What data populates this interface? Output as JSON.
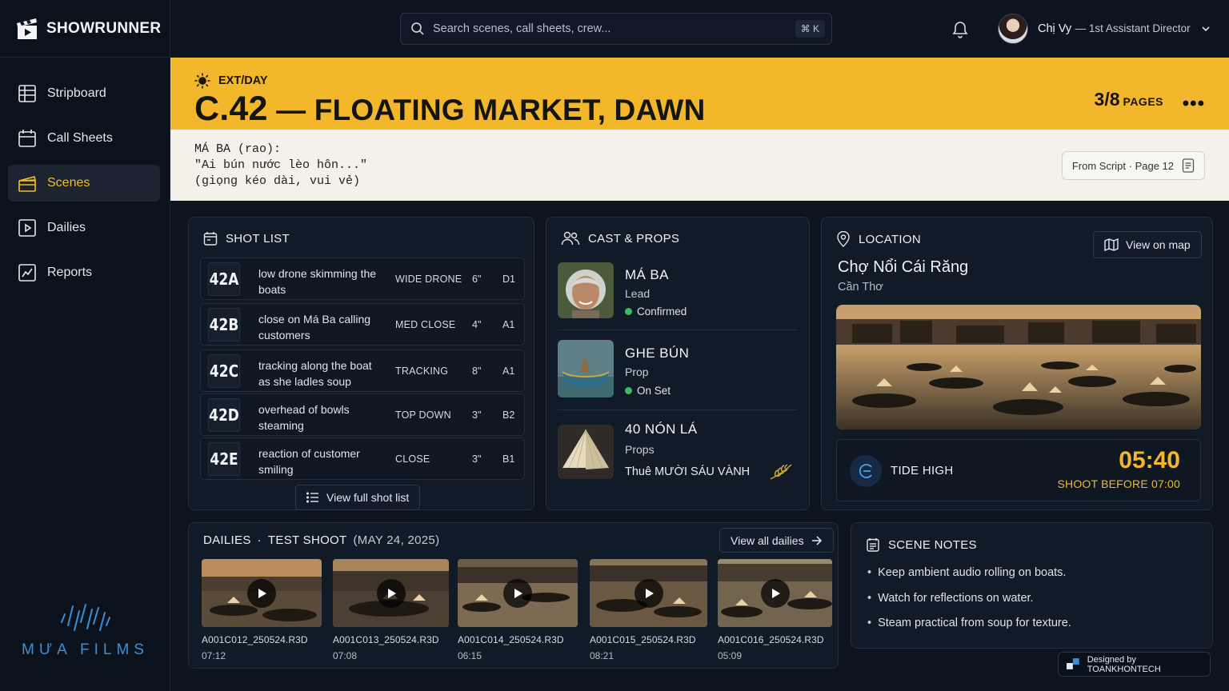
{
  "app": {
    "name": "SHOWRUNNER",
    "studio": "MƯA FILMS"
  },
  "nav": [
    {
      "label": "Stripboard",
      "icon": "stripboard-icon",
      "active": false
    },
    {
      "label": "Call Sheets",
      "icon": "calendar-icon",
      "active": false
    },
    {
      "label": "Scenes",
      "icon": "clapperboard-icon",
      "active": true
    },
    {
      "label": "Dailies",
      "icon": "play-icon",
      "active": false
    },
    {
      "label": "Reports",
      "icon": "chart-icon",
      "active": false
    }
  ],
  "search": {
    "placeholder": "Search scenes, call sheets, crew...",
    "shortcut": "⌘ K"
  },
  "user": {
    "name": "Chị Vy",
    "role": "— 1st Assistant Director"
  },
  "scene": {
    "ext_day": "EXT/DAY",
    "number": "C.42",
    "title": "— FLOATING MARKET, DAWN",
    "pages": "3/8",
    "pages_label": "PAGES",
    "more": "•••"
  },
  "script": {
    "lines": [
      "MÁ BA (rao):",
      "\"Ai bún nước lèo hôn...\"",
      "(giọng kéo dài, vui vẻ)"
    ],
    "source": "From Script · Page 12"
  },
  "shot_list": {
    "title": "SHOT LIST",
    "shots": [
      {
        "id": "42A",
        "desc": "low drone skimming the boats",
        "type": "WIDE DRONE",
        "length": "6\"",
        "setup": "D1"
      },
      {
        "id": "42B",
        "desc": "close on Má Ba calling customers",
        "type": "MED CLOSE",
        "length": "4\"",
        "setup": "A1"
      },
      {
        "id": "42C",
        "desc": "tracking along the boat as she ladles soup",
        "type": "TRACKING",
        "length": "8\"",
        "setup": "A1"
      },
      {
        "id": "42D",
        "desc": "overhead of bowls steaming",
        "type": "TOP DOWN",
        "length": "3\"",
        "setup": "B2"
      },
      {
        "id": "42E",
        "desc": "reaction of customer smiling",
        "type": "CLOSE",
        "length": "3\"",
        "setup": "B1"
      }
    ],
    "view_all": "View full shot list"
  },
  "cast_props": {
    "title": "CAST & PROPS",
    "items": [
      {
        "name": "MÁ BA",
        "role": "Lead",
        "status": "Confirmed"
      },
      {
        "name": "GHE BÚN",
        "role": "Prop",
        "status": "On Set"
      },
      {
        "name": "40 NÓN LÁ",
        "role": "Props",
        "note": "Thuê MƯỜI SÁU VÀNH"
      }
    ],
    "status_color": "#3dbb63"
  },
  "location": {
    "title": "LOCATION",
    "view_map": "View on map",
    "name": "Chợ Nổi Cái Răng",
    "city": "Cần Thơ",
    "tide_label": "TIDE HIGH",
    "tide_time": "05:40",
    "tide_note": "SHOOT BEFORE 07:00"
  },
  "dailies": {
    "title": "DAILIES",
    "separator": "·",
    "subtitle": "TEST SHOOT",
    "date": "(MAY 24, 2025)",
    "view_all": "View all dailies",
    "clips": [
      {
        "file": "A001C012_250524.R3D",
        "duration": "07:12"
      },
      {
        "file": "A001C013_250524.R3D",
        "duration": "07:08"
      },
      {
        "file": "A001C014_250524.R3D",
        "duration": "06:15"
      },
      {
        "file": "A001C015_250524.R3D",
        "duration": "08:21"
      },
      {
        "file": "A001C016_250524.R3D",
        "duration": "05:09"
      }
    ]
  },
  "scene_notes": {
    "title": "SCENE NOTES",
    "notes": [
      "Keep ambient audio rolling on boats.",
      "Watch for reflections on water.",
      "Steam practical from soup for texture."
    ]
  },
  "credit": "Designed by TOANKHONTECH",
  "colors": {
    "accent": "#f2b72a",
    "background": "#0d1420",
    "panel": "#111a27",
    "link_blue": "#3a8fd6"
  }
}
